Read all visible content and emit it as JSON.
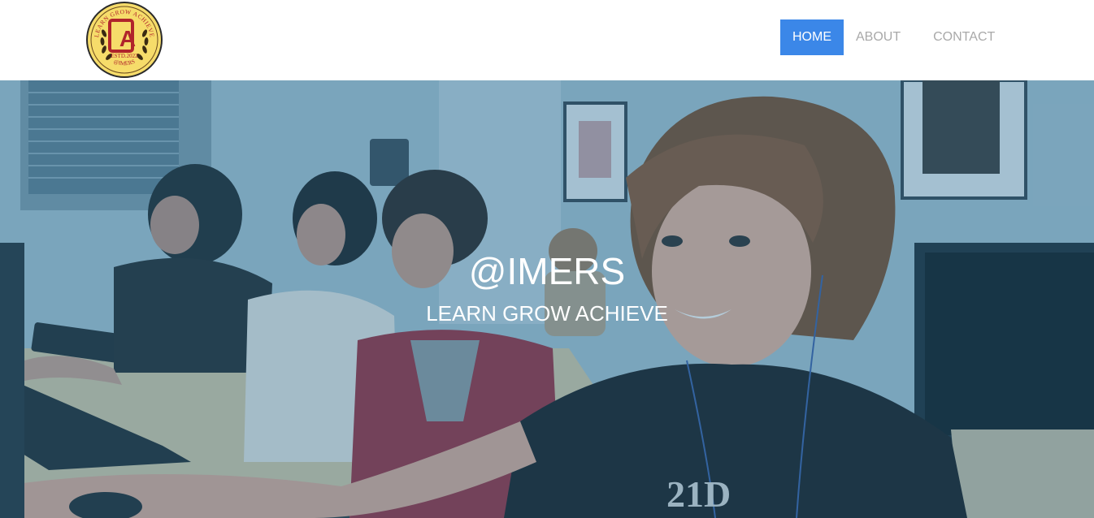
{
  "brand": {
    "logo_text_top": "LEARN GROW ACHIEVE",
    "logo_monogram": "A",
    "logo_established": "ESTD.2022",
    "logo_text_bottom": "@IMERS",
    "colors": {
      "gold": "#f6dc6a",
      "crimson": "#b0242b",
      "outline": "#2a2a2a"
    }
  },
  "nav": {
    "items": [
      {
        "label": "HOME",
        "active": true
      },
      {
        "label": "ABOUT",
        "active": false
      },
      {
        "label": "CONTACT",
        "active": false
      }
    ],
    "active_color": "#3b87e8",
    "inactive_color": "#a9a9a9"
  },
  "hero": {
    "title": "@IMERS",
    "subtitle": "LEARN GROW ACHIEVE",
    "image_subject": "students working at computers in a classroom",
    "shirt_text": "21D"
  }
}
